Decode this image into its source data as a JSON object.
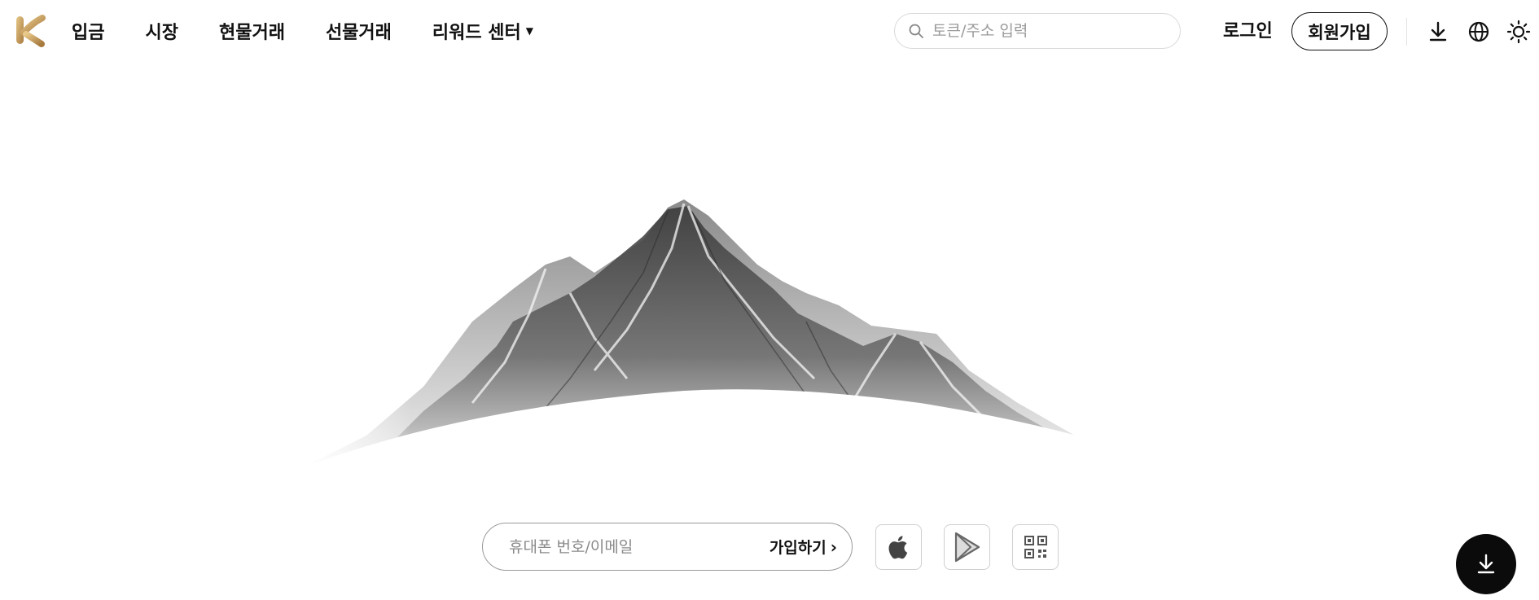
{
  "nav": {
    "items": [
      {
        "label": "입금"
      },
      {
        "label": "시장"
      },
      {
        "label": "현물거래"
      },
      {
        "label": "선물거래"
      },
      {
        "label": "리워드 센터",
        "has_dropdown": true
      }
    ]
  },
  "search": {
    "placeholder": "토큰/주소 입력"
  },
  "auth": {
    "login_label": "로그인",
    "signup_label": "회원가입"
  },
  "header_icons": [
    "download-icon",
    "globe-icon",
    "sun-icon"
  ],
  "signup_form": {
    "placeholder": "휴대폰 번호/이메일",
    "cta_label": "가입하기"
  },
  "store_buttons": [
    "apple-icon",
    "google-play-icon",
    "qr-code-icon"
  ],
  "colors": {
    "brand_gold": "#c9a25e",
    "text": "#111111",
    "fab_bg": "#0b0b0b"
  }
}
